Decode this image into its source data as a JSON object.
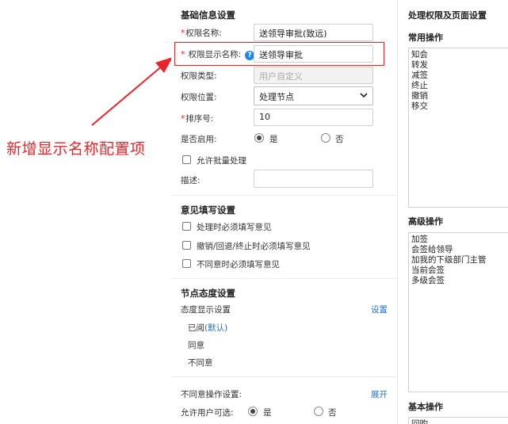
{
  "annotation": {
    "text": "新增显示名称配置项"
  },
  "basic": {
    "title": "基础信息设置",
    "perm_name_label": "权限名称:",
    "perm_name_value": "送领导审批(致远)",
    "display_name_label": "权限显示名称:",
    "display_name_value": "送领导审批",
    "help_glyph": "?",
    "type_label": "权限类型:",
    "type_value": "用户自定义",
    "position_label": "权限位置:",
    "position_value": "处理节点",
    "sort_label": "排序号:",
    "sort_value": "10",
    "enabled_label": "是否启用:",
    "yes": "是",
    "no": "否",
    "batch_label": "允许批量处理",
    "desc_label": "描述:",
    "desc_value": ""
  },
  "opinion": {
    "title": "意见填写设置",
    "options": [
      "处理时必须填写意见",
      "撤销/回退/终止时必须填写意见",
      "不同意时必须填写意见"
    ]
  },
  "attitude": {
    "title": "节点态度设置",
    "display_label": "态度显示设置",
    "set_link": "设置",
    "items": [
      "已阅",
      "同意",
      "不同意"
    ],
    "default_tag": "(默认)",
    "disagree_label": "不同意操作设置:",
    "expand_link": "展开",
    "allow_label": "允许用户可选:",
    "yes": "是",
    "no": "否"
  },
  "right_panel": {
    "title": "处理权限及页面设置",
    "common_title": "常用操作",
    "common_ops": [
      "知会",
      "转发",
      "减签",
      "终止",
      "撤销",
      "移交"
    ],
    "advanced_title": "高级操作",
    "advanced_ops": [
      "加签",
      "会签给领导",
      "加我的下级部门主管",
      "当前会签",
      "多级会签"
    ],
    "basic_title": "基本操作",
    "basic_ops": [
      "回购"
    ]
  },
  "colors": {
    "annotation": "#e8262a",
    "link": "#1f6fd1",
    "help_icon": "#1e88e5"
  }
}
